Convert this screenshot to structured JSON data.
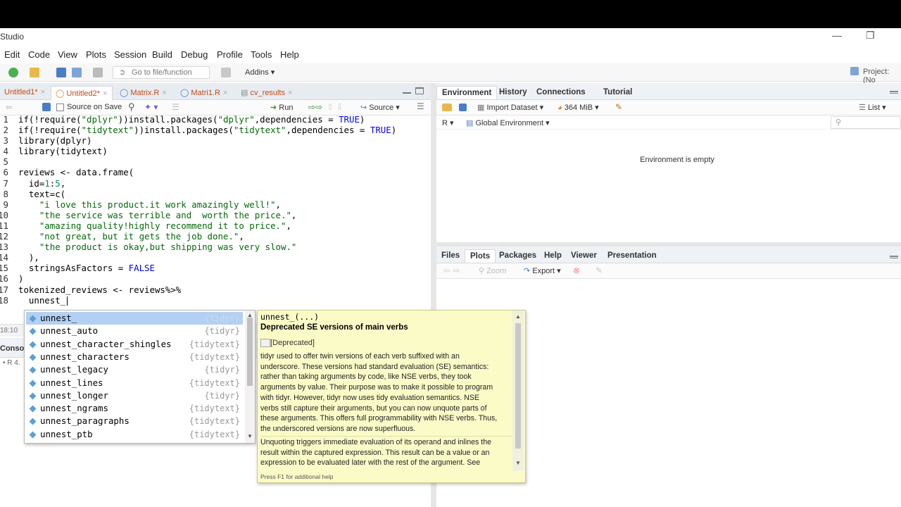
{
  "app": {
    "title": "Studio"
  },
  "menu": [
    "Edit",
    "Code",
    "View",
    "Plots",
    "Session",
    "Build",
    "Debug",
    "Profile",
    "Tools",
    "Help"
  ],
  "toolbar": {
    "goto_placeholder": "Go to file/function",
    "addins": "Addins",
    "project": "Project: (No"
  },
  "source_tabs": [
    {
      "label": "Untitled1*",
      "active": false
    },
    {
      "label": "Untitled2*",
      "active": true
    },
    {
      "label": "Matrix.R",
      "active": false
    },
    {
      "label": "Matri1.R",
      "active": false
    },
    {
      "label": "cv_results",
      "active": false
    }
  ],
  "editor_toolbar": {
    "source_on_save": "Source on Save",
    "run": "Run",
    "source": "Source"
  },
  "code_lines": [
    {
      "n": "1",
      "html": "if(!require(<span class='str'>\"dplyr\"</span>))install.packages(<span class='str'>\"dplyr\"</span>,dependencies = <span class='kw'>TRUE</span>)"
    },
    {
      "n": "2",
      "html": "if(!require(<span class='str'>\"tidytext\"</span>))install.packages(<span class='str'>\"tidytext\"</span>,dependencies = <span class='kw'>TRUE</span>)"
    },
    {
      "n": "3",
      "html": "library(dplyr)"
    },
    {
      "n": "4",
      "html": "library(tidytext)"
    },
    {
      "n": "5",
      "html": ""
    },
    {
      "n": "6",
      "html": "reviews &lt;- data.frame("
    },
    {
      "n": "7",
      "html": "  id=<span class='num'>1</span>:<span class='num'>5</span>,"
    },
    {
      "n": "8",
      "html": "  text=c("
    },
    {
      "n": "9",
      "html": "    <span class='str'>\"i love this product.it work amazingly well!\"</span>,"
    },
    {
      "n": "10",
      "html": "    <span class='str'>\"the service was terrible and  worth the price.\"</span>,"
    },
    {
      "n": "11",
      "html": "    <span class='str'>\"amazing quality!highly recommend it to price.\"</span>,"
    },
    {
      "n": "12",
      "html": "    <span class='str'>\"not great, but it gets the job done.\"</span>,"
    },
    {
      "n": "13",
      "html": "    <span class='str'>\"the product is okay,but shipping was very slow.\"</span>"
    },
    {
      "n": "14",
      "html": "  ),"
    },
    {
      "n": "15",
      "html": "  stringsAsFactors = <span class='kw'>FALSE</span>"
    },
    {
      "n": "16",
      "html": ")"
    },
    {
      "n": "17",
      "html": "tokenized_reviews &lt;- reviews%&gt;%"
    },
    {
      "n": "18",
      "html": "  unnest_"
    }
  ],
  "status": {
    "position": "18:10",
    "console_label": "Console",
    "r_version": "R 4."
  },
  "env_tabs": [
    "Environment",
    "History",
    "Connections",
    "Tutorial"
  ],
  "env_toolbar": {
    "import": "Import Dataset",
    "memory": "364 MiB",
    "list": "List",
    "r": "R",
    "global": "Global Environment"
  },
  "env_empty": "Environment is empty",
  "files_tabs": [
    "Files",
    "Plots",
    "Packages",
    "Help",
    "Viewer",
    "Presentation"
  ],
  "plots_toolbar": {
    "zoom": "Zoom",
    "export": "Export"
  },
  "autocomplete": [
    {
      "name": "unnest_",
      "pkg": "{tidyr}",
      "selected": true
    },
    {
      "name": "unnest_auto",
      "pkg": "{tidyr}"
    },
    {
      "name": "unnest_character_shingles",
      "pkg": "{tidytext}"
    },
    {
      "name": "unnest_characters",
      "pkg": "{tidytext}"
    },
    {
      "name": "unnest_legacy",
      "pkg": "{tidyr}"
    },
    {
      "name": "unnest_lines",
      "pkg": "{tidytext}"
    },
    {
      "name": "unnest_longer",
      "pkg": "{tidyr}"
    },
    {
      "name": "unnest_ngrams",
      "pkg": "{tidytext}"
    },
    {
      "name": "unnest_paragraphs",
      "pkg": "{tidytext}"
    },
    {
      "name": "unnest_ptb",
      "pkg": "{tidytext}"
    }
  ],
  "help": {
    "signature": "unnest_(...)",
    "title": "Deprecated SE versions of main verbs",
    "deprecated": "[Deprecated]",
    "para1": [
      "tidyr used to offer twin versions of each verb suffixed with an",
      "underscore. These versions had standard evaluation (SE) semantics:",
      "rather than taking arguments by code, like NSE verbs, they took",
      "arguments by value. Their purpose was to make it possible to program",
      "with tidyr. However, tidyr now uses tidy evaluation semantics. NSE",
      "verbs still capture their arguments, but you can now unquote parts of",
      "these arguments. This offers full programmability with NSE verbs. Thus,",
      "the underscored versions are now superfluous."
    ],
    "para2": [
      "Unquoting triggers immediate evaluation of its operand and inlines the",
      "result within the captured expression. This result can be a value or an",
      "expression to be evaluated later with the rest of the argument. See"
    ],
    "footer": "Press F1 for additional help"
  }
}
